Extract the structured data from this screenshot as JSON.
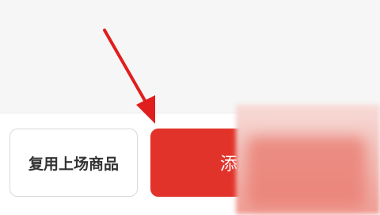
{
  "bottom_bar": {
    "reuse_button_label": "复用上场商品",
    "add_button_label": "添加商品"
  },
  "colors": {
    "primary_red": "#e2332b",
    "arrow_red": "#e01e1e",
    "border_gray": "#d9d9d9",
    "text_dark": "#333333",
    "background": "#f6f6f6"
  },
  "annotation": {
    "icon": "red-arrow-icon"
  }
}
